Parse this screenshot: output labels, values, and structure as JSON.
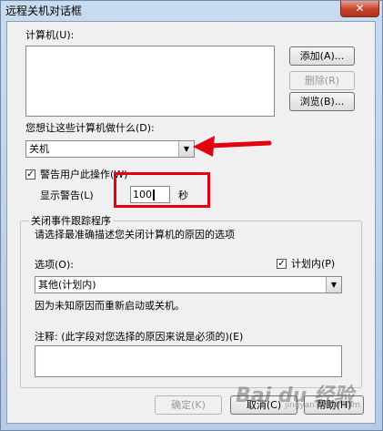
{
  "window": {
    "title": "远程关机对话框",
    "close_label": "✕"
  },
  "computers": {
    "label": "计算机(U):",
    "add_label": "添加(A)...",
    "delete_label": "删除(R)",
    "browse_label": "浏览(B)..."
  },
  "action": {
    "label": "您想让这些计算机做什么(D):",
    "selected": "关机"
  },
  "warn": {
    "checkbox_label": "警告用户此操作(W)",
    "checked": true,
    "display_label": "显示警告(L)",
    "seconds_value": "100",
    "seconds_unit": "秒"
  },
  "tracker": {
    "group_title": "关闭事件跟踪程序",
    "description": "请选择最准确描述您关闭计算机的原因的选项",
    "options_label": "选项(O):",
    "planned_label": "计划内(P)",
    "planned_checked": true,
    "selected_reason": "其他(计划内)",
    "reason_description": "因为未知原因而重新启动或关机。",
    "comment_label": "注释: (此字段对您选择的原因来说是必须的)(E)"
  },
  "buttons": {
    "ok_label": "确定(K)",
    "cancel_label": "取消(C)",
    "help_label": "帮助(H)"
  },
  "watermark": {
    "brand": "Bai du 经验",
    "url": "jingyan.baidu.com"
  },
  "colors": {
    "annotation_red": "#e3000f",
    "close_red": "#c7452f"
  }
}
